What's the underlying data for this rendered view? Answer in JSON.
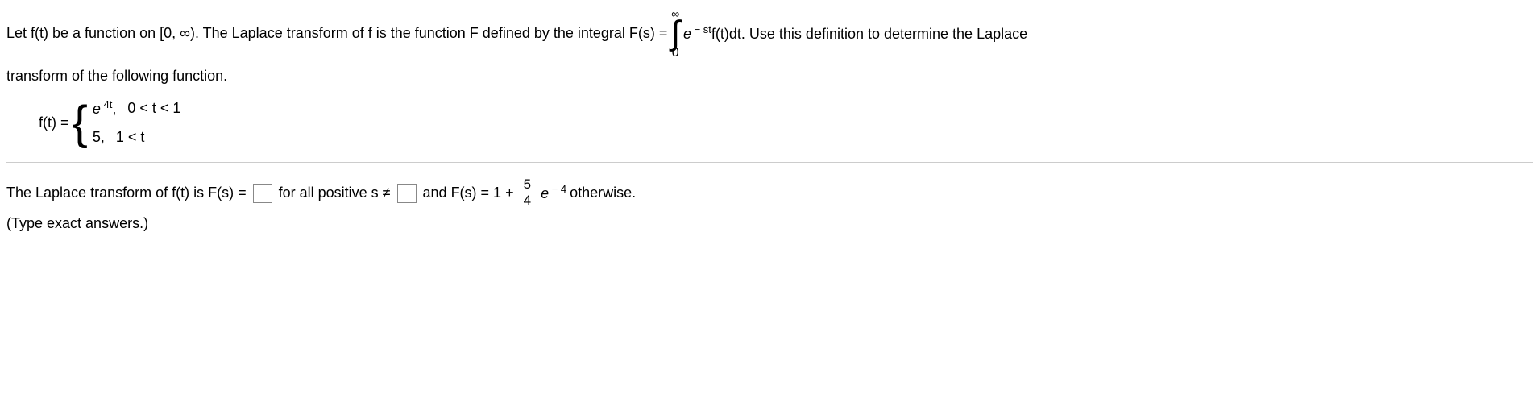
{
  "problem": {
    "intro_before_integral": "Let f(t) be a function on [0, ∞). The Laplace transform of f is the function F defined by the integral F(s) =",
    "integral_upper": "∞",
    "integral_lower": "0",
    "integrand_e": "e",
    "integrand_exp": " − st",
    "integrand_rest": "f(t)dt. Use this definition to determine the Laplace",
    "intro_line2": "transform of the following function."
  },
  "piecewise": {
    "lhs": "f(t) =",
    "row1_func_e": "e",
    "row1_func_exp": " 4t",
    "row1_comma": ",",
    "row1_cond": "0 < t < 1",
    "row2_func": "5,",
    "row2_cond": "1 < t"
  },
  "answer": {
    "text1": "The Laplace transform of f(t) is F(s) =",
    "text2": "for all positive s ≠",
    "text3": "and F(s) = 1 +",
    "frac_num": "5",
    "frac_den": "4",
    "e": "e",
    "exp": " − 4",
    "text4": " otherwise.",
    "note": "(Type exact answers.)"
  }
}
